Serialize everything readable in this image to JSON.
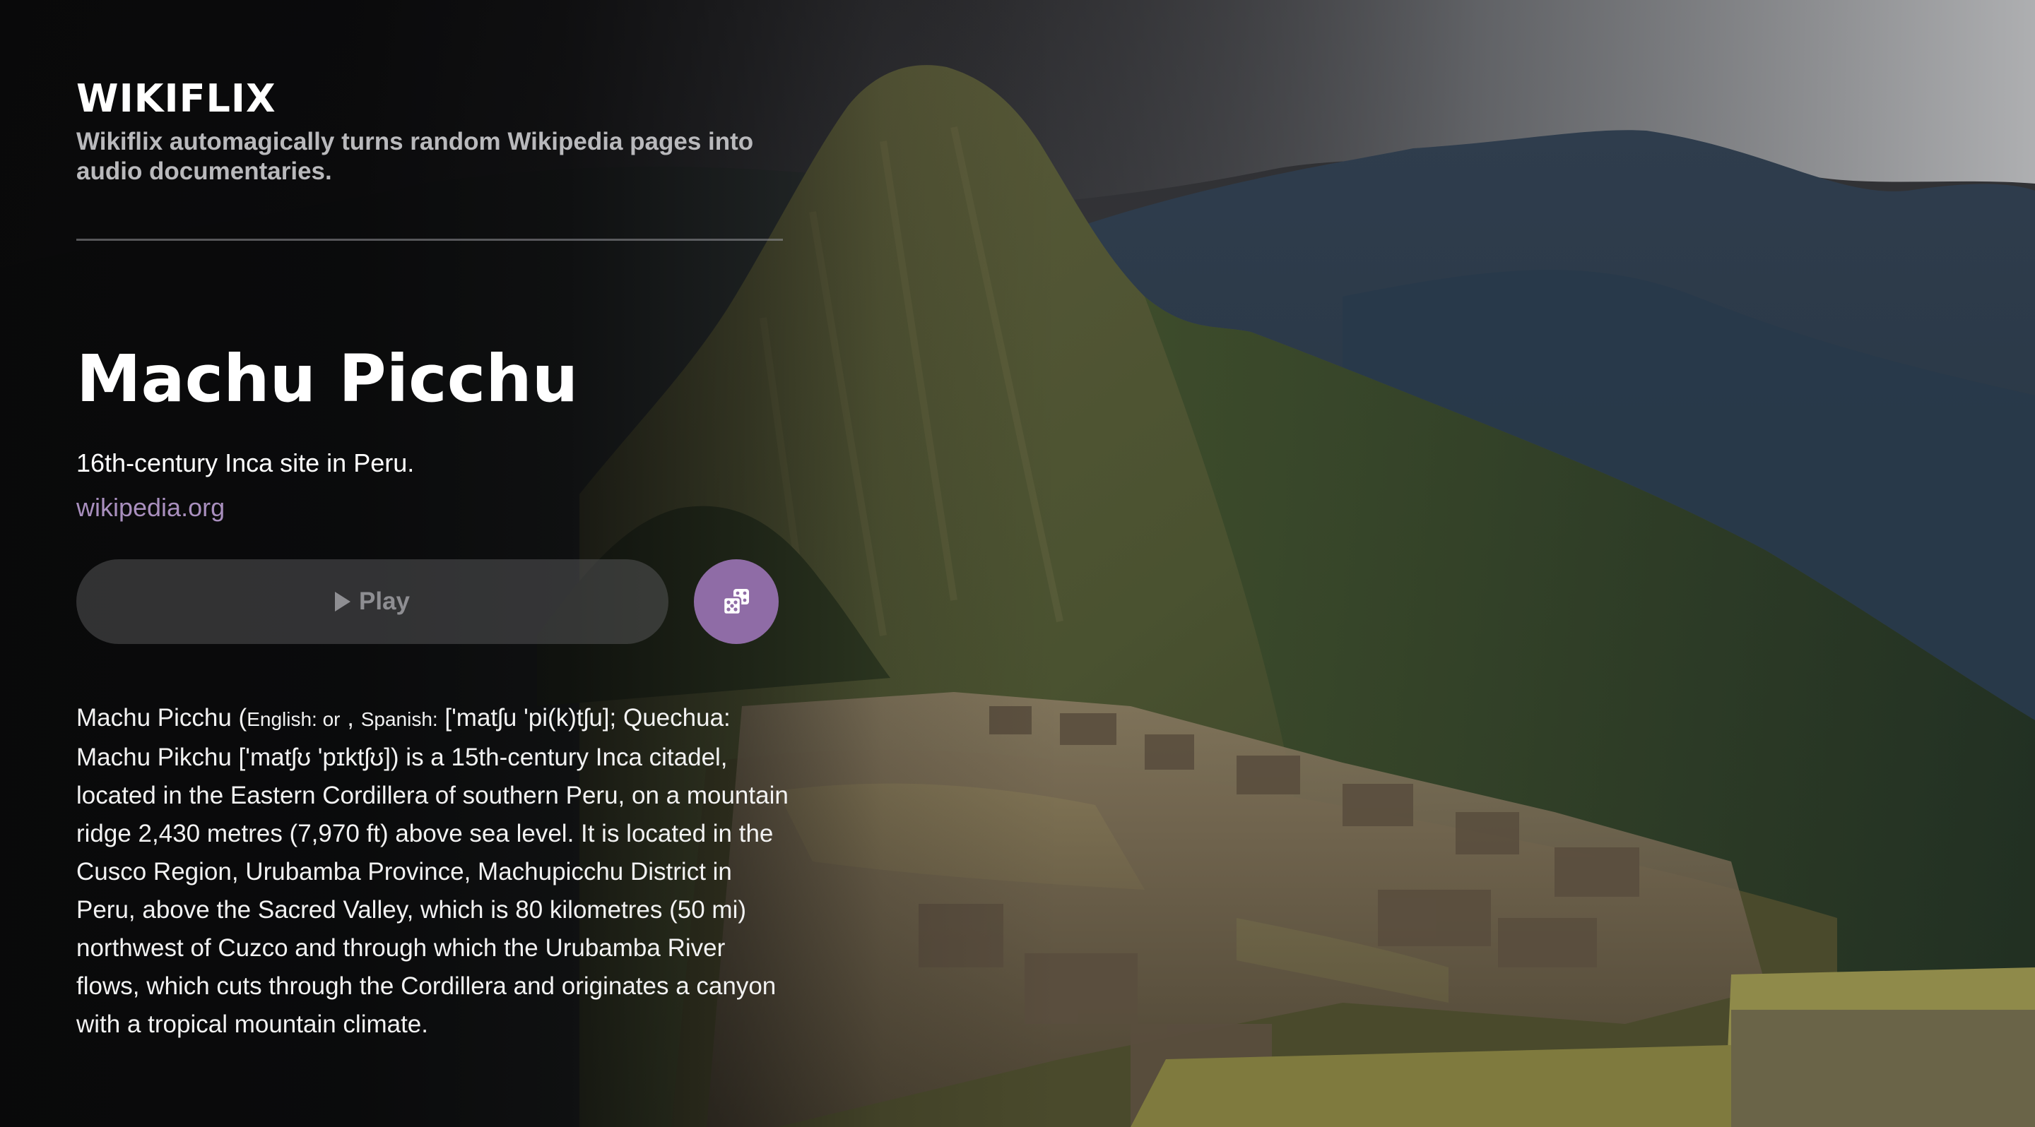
{
  "brand": {
    "name": "WIKIFLIX",
    "tagline": "Wikiflix automagically turns random Wikipedia pages into audio documentaries."
  },
  "article": {
    "title": "Machu Picchu",
    "description": "16th-century Inca site in Peru.",
    "source": "wikipedia.org",
    "summary": {
      "part1": "Machu Picchu (",
      "english_label": "English: or",
      "part2": " , ",
      "spanish_label": "Spanish:",
      "part3": " ['matʃu 'pi(k)tʃu]; Quechua: Machu Pikchu ['matʃʊ 'pɪktʃʊ]) is a 15th-century Inca citadel, located in the Eastern Cordillera of southern Peru, on a mountain ridge 2,430 metres (7,970 ft) above sea level. It is located in the Cusco Region, Urubamba Province, Machupicchu District in Peru, above the Sacred Valley, which is 80 kilometres (50 mi) northwest of Cuzco and through which the Urubamba River flows, which cuts through the Cordillera and originates a canyon with a tropical mountain climate."
    }
  },
  "controls": {
    "play_label": "Play",
    "play_icon": "play-icon",
    "random_icon": "dice-icon"
  },
  "colors": {
    "accent": "#8f6ca6",
    "link": "#a98fbe",
    "play_button_bg": "#4a4a4c",
    "tagline": "#b9b9bc"
  },
  "background": {
    "icon": "mountain-landscape-image"
  }
}
